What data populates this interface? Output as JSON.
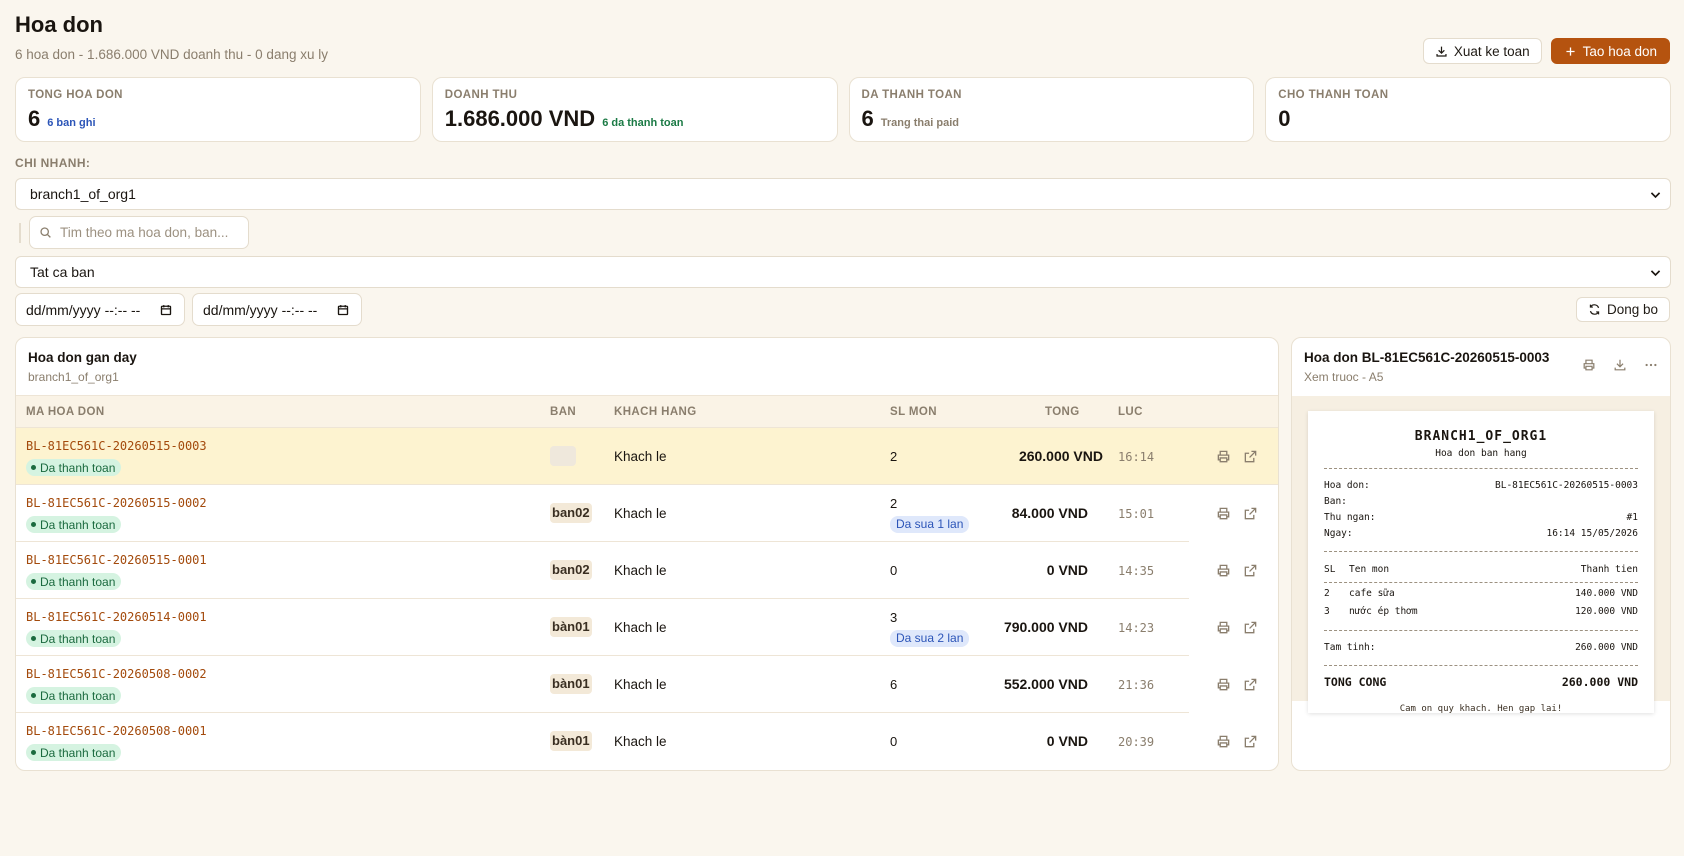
{
  "header": {
    "title": "Hoa don",
    "subtitle": "6 hoa don - 1.686.000 VND doanh thu - 0 dang xu ly",
    "export_label": "Xuat ke toan",
    "create_label": "Tao hoa don"
  },
  "stats": [
    {
      "label": "TONG HOA DON",
      "value": "6",
      "note": "6 ban ghi",
      "note_color": "#2c55b8"
    },
    {
      "label": "DOANH THU",
      "value": "1.686.000 VND",
      "note": "6 da thanh toan",
      "note_color": "#1b7a45"
    },
    {
      "label": "DA THANH TOAN",
      "value": "6",
      "note": "Trang thai paid",
      "note_color": "#8a7e6d"
    },
    {
      "label": "CHO THANH TOAN",
      "value": "0",
      "note": "",
      "note_color": "#8a7e6d"
    }
  ],
  "filters": {
    "branch_label": "CHI NHANH:",
    "branch_value": "branch1_of_org1",
    "search_placeholder": "Tim theo ma hoa don, ban...",
    "table_value": "Tat ca ban",
    "date_from": "dd/mm/yyyy --:-- --",
    "date_to": "dd/mm/yyyy --:-- --",
    "sync_label": "Dong bo"
  },
  "list": {
    "title": "Hoa don gan day",
    "subtitle": "branch1_of_org1",
    "columns": {
      "code": "MA HOA DON",
      "table": "BAN",
      "customer": "KHACH HANG",
      "qty": "SL MON",
      "total": "TONG",
      "time": "LUC"
    },
    "rows": [
      {
        "code": "BL-81EC561C-20260515-0003",
        "status": "Da thanh toan",
        "table": "",
        "customer": "Khach le",
        "qty": "2",
        "edit": "",
        "total": "260.000 VND",
        "time": "16:14"
      },
      {
        "code": "BL-81EC561C-20260515-0002",
        "status": "Da thanh toan",
        "table": "ban02",
        "customer": "Khach le",
        "qty": "2",
        "edit": "Da sua 1 lan",
        "total": "84.000 VND",
        "time": "15:01"
      },
      {
        "code": "BL-81EC561C-20260515-0001",
        "status": "Da thanh toan",
        "table": "ban02",
        "customer": "Khach le",
        "qty": "0",
        "edit": "",
        "total": "0 VND",
        "time": "14:35"
      },
      {
        "code": "BL-81EC561C-20260514-0001",
        "status": "Da thanh toan",
        "table": "bàn01",
        "customer": "Khach le",
        "qty": "3",
        "edit": "Da sua 2 lan",
        "total": "790.000 VND",
        "time": "14:23"
      },
      {
        "code": "BL-81EC561C-20260508-0002",
        "status": "Da thanh toan",
        "table": "bàn01",
        "customer": "Khach le",
        "qty": "6",
        "edit": "",
        "total": "552.000 VND",
        "time": "21:36"
      },
      {
        "code": "BL-81EC561C-20260508-0001",
        "status": "Da thanh toan",
        "table": "bàn01",
        "customer": "Khach le",
        "qty": "0",
        "edit": "",
        "total": "0 VND",
        "time": "20:39"
      }
    ]
  },
  "preview": {
    "title": "Hoa don BL-81EC561C-20260515-0003",
    "subtitle": "Xem truoc - A5",
    "receipt": {
      "branch": "BRANCH1_OF_ORG1",
      "type": "Hoa don ban hang",
      "info": [
        {
          "label": "Hoa don:",
          "value": "BL-81EC561C-20260515-0003"
        },
        {
          "label": "Ban:",
          "value": ""
        },
        {
          "label": "Thu ngan:",
          "value": "#1"
        },
        {
          "label": "Ngay:",
          "value": "16:14 15/05/2026"
        }
      ],
      "items_header": {
        "qty": "SL",
        "name": "Ten mon",
        "amount": "Thanh tien"
      },
      "items": [
        {
          "qty": "2",
          "name": "cafe sữa",
          "amount": "140.000 VND"
        },
        {
          "qty": "3",
          "name": "nước ép thơm",
          "amount": "120.000 VND"
        }
      ],
      "subtotal_label": "Tam tinh:",
      "subtotal_value": "260.000 VND",
      "grand_label": "TONG CONG",
      "grand_value": "260.000 VND",
      "thanks": "Cam on quy khach. Hen gap lai!"
    }
  },
  "colors": {
    "accent": "#b5530f",
    "background": "#faf6ee",
    "selected_row": "#fdf3d0",
    "paid_badge": "#d5f3e1"
  }
}
